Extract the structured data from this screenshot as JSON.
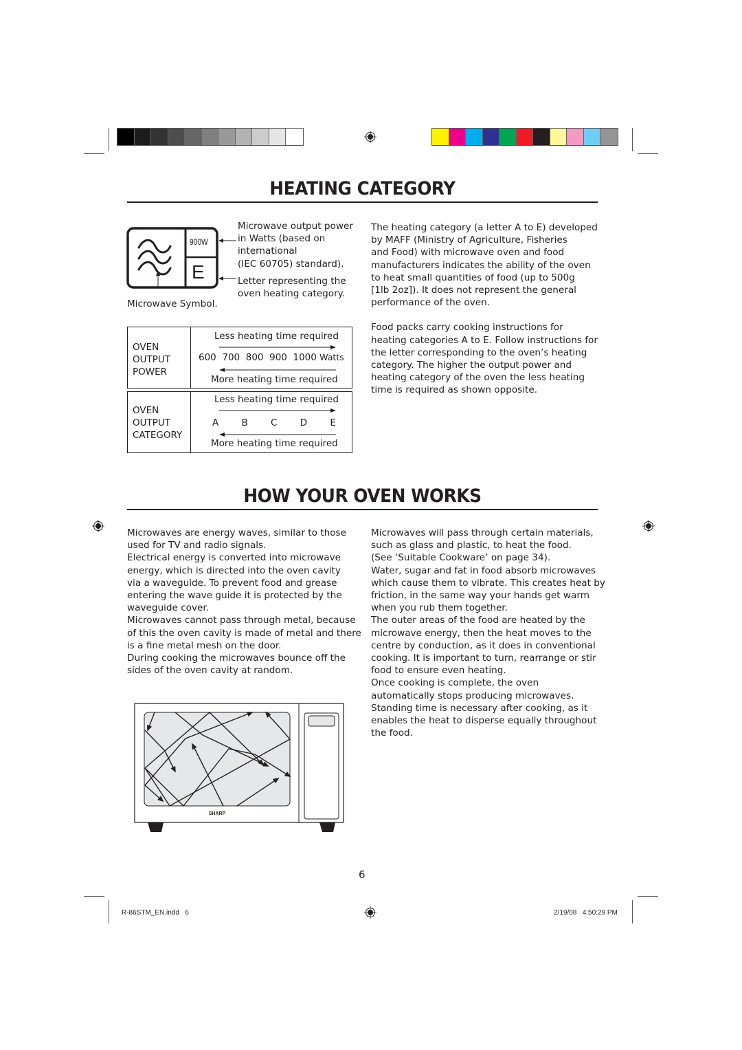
{
  "color_bars": {
    "grayscale": [
      "#000000",
      "#1c1c1c",
      "#333333",
      "#4d4d4d",
      "#666666",
      "#808080",
      "#999999",
      "#b3b3b3",
      "#cccccc",
      "#e6e6e6",
      "#ffffff"
    ],
    "process": [
      "#fff200",
      "#ec008c",
      "#00aeef",
      "#2e3192",
      "#00a651",
      "#ed1c24",
      "#231f20",
      "#fff799",
      "#f49ac1",
      "#6dcff6",
      "#939598"
    ]
  },
  "heating_category": {
    "title": "HEATING CATEGORY",
    "symbol": {
      "power_label": "900W",
      "category_letter": "E",
      "power_caption": [
        "Microwave output power",
        "in Watts (based on",
        "international",
        "(IEC 60705) standard)."
      ],
      "letter_caption": [
        "Letter representing the",
        "oven heating category."
      ],
      "symbol_caption": "Microwave Symbol."
    },
    "power_table": {
      "label_lines": [
        "OVEN",
        "OUTPUT",
        "POWER"
      ],
      "top_text": "Less heating time required",
      "values": [
        "600",
        "700",
        "800",
        "900",
        "1000"
      ],
      "unit": "Watts",
      "bottom_text": "More heating time required"
    },
    "category_table": {
      "label_lines": [
        "OVEN",
        "OUTPUT",
        "CATEGORY"
      ],
      "top_text": "Less heating time required",
      "values": [
        "A",
        "B",
        "C",
        "D",
        "E"
      ],
      "bottom_text": "More heating time required"
    },
    "paragraphs": [
      [
        "The heating category (a letter A to E) developed",
        "by MAFF (Ministry of Agriculture, Fisheries",
        "and Food) with microwave oven and food",
        "manufacturers indicates the ability of the oven",
        "to heat small quantities of food (up to 500g",
        "[1lb 2oz]). It does not represent the general",
        "performance of the oven."
      ],
      [
        "Food packs carry cooking instructions for",
        "heating categories A to E. Follow instructions for",
        "the letter corresponding to the oven’s heating",
        "category. The higher the output power and",
        "heating category of the oven the less heating",
        "time is required as shown opposite."
      ]
    ]
  },
  "how_oven_works": {
    "title": "HOW YOUR OVEN WORKS",
    "left_column": [
      "Microwaves are energy waves, similar to those",
      "used for TV and radio signals.",
      "Electrical energy is converted into microwave",
      "energy, which is directed into the oven cavity",
      "via a waveguide. To prevent food and grease",
      "entering the wave guide it is protected by the",
      "waveguide cover.",
      "Microwaves cannot pass through metal, because",
      "of this the oven cavity is made of metal and there",
      "is a fine metal mesh on the door.",
      "During cooking the microwaves bounce off the",
      "sides of the oven cavity at random."
    ],
    "right_column": [
      "Microwaves will pass through certain materials,",
      "such as glass and plastic, to heat the food.",
      "(See ‘Suitable Cookware’ on page 34).",
      "Water, sugar and fat in food absorb microwaves",
      "which cause them to vibrate. This creates heat by",
      "friction, in the same way your hands get warm",
      "when you rub them together.",
      "The outer areas of the food are heated by the",
      "microwave energy, then the heat moves to the",
      "centre by conduction, as it does in conventional",
      "cooking. It is important to turn, rearrange or stir",
      "food to ensure even heating.",
      "Once cooking is complete, the oven",
      "automatically stops producing microwaves.",
      "Standing time is necessary after cooking, as it",
      "enables the heat to disperse equally throughout",
      "the food."
    ],
    "illustration_brand": "SHARP"
  },
  "page_number": "6",
  "footer": {
    "file": "R-86STM_EN.indd   6",
    "timestamp": "2/19/08   4:50:29 PM"
  }
}
